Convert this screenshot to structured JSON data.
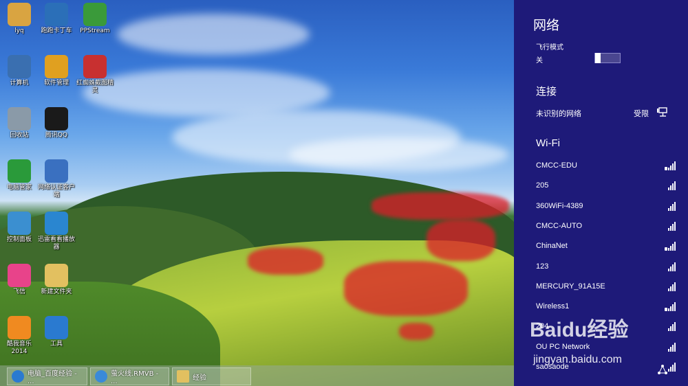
{
  "desktop": {
    "icons": [
      {
        "label": "lyq",
        "icon": "user-folder-icon",
        "color": "#d9a441"
      },
      {
        "label": "跑跑卡丁车",
        "icon": "kart-game-icon",
        "color": "#2b6fb8"
      },
      {
        "label": "PPStream",
        "icon": "pps-icon",
        "color": "#3a9a3a"
      },
      {
        "label": "计算机",
        "icon": "computer-icon",
        "color": "#3a6fb0"
      },
      {
        "label": "软件管理",
        "icon": "software-manager-icon",
        "color": "#e0a020"
      },
      {
        "label": "红蜘蛛截图精灵",
        "icon": "spider-capture-icon",
        "color": "#c83030"
      },
      {
        "label": "回收站",
        "icon": "recycle-bin-icon",
        "color": "#8a9aa8"
      },
      {
        "label": "腾讯QQ",
        "icon": "qq-icon",
        "color": "#1a1a1a"
      },
      {
        "label": "电脑管家",
        "icon": "pc-manager-icon",
        "color": "#2a9a3a"
      },
      {
        "label": "网络认证客户端",
        "icon": "network-auth-icon",
        "color": "#3a70c0"
      },
      {
        "label": "控制面板",
        "icon": "control-panel-icon",
        "color": "#3b8fd0"
      },
      {
        "label": "迅雷看看播放器",
        "icon": "xunlei-player-icon",
        "color": "#2a86d0"
      },
      {
        "label": "飞信",
        "icon": "fetion-icon",
        "color": "#e8438a"
      },
      {
        "label": "新建文件夹",
        "icon": "folder-icon",
        "color": "#e2c060"
      },
      {
        "label": "酷我音乐2014",
        "icon": "kuwo-music-icon",
        "color": "#f08a20"
      },
      {
        "label": "工具",
        "icon": "tools-icon",
        "color": "#2a7ad0"
      }
    ]
  },
  "taskbar": {
    "items": [
      {
        "label": "电脑_百度经验 - ...",
        "icon": "browser-icon",
        "color": "#2a7ad0"
      },
      {
        "label": "萤火线.RMVB - ...",
        "icon": "media-player-icon",
        "color": "#3a8ad8"
      },
      {
        "label": "经验",
        "icon": "folder-icon",
        "color": "#e2c060"
      }
    ]
  },
  "panel": {
    "title": "网络",
    "airplane_mode_label": "飞行模式",
    "airplane_mode_value": "关",
    "connections_heading": "连接",
    "current_network": "未识别的网络",
    "current_status": "受限",
    "wifi_heading": "Wi-Fi",
    "wifi_networks": [
      {
        "name": "CMCC-EDU",
        "secured": true
      },
      {
        "name": "205",
        "secured": false
      },
      {
        "name": "360WiFi-4389",
        "secured": false
      },
      {
        "name": "CMCC-AUTO",
        "secured": false
      },
      {
        "name": "ChinaNet",
        "secured": true
      },
      {
        "name": "123",
        "secured": false
      },
      {
        "name": "MERCURY_91A15E",
        "secured": false
      },
      {
        "name": "Wireless1",
        "secured": true
      },
      {
        "name": "204",
        "secured": false
      },
      {
        "name": "OU PC Network",
        "secured": false
      },
      {
        "name": "saosaode",
        "secured": false
      }
    ]
  },
  "watermark": {
    "brand": "Baidu经验",
    "url": "jingyan.baidu.com"
  }
}
